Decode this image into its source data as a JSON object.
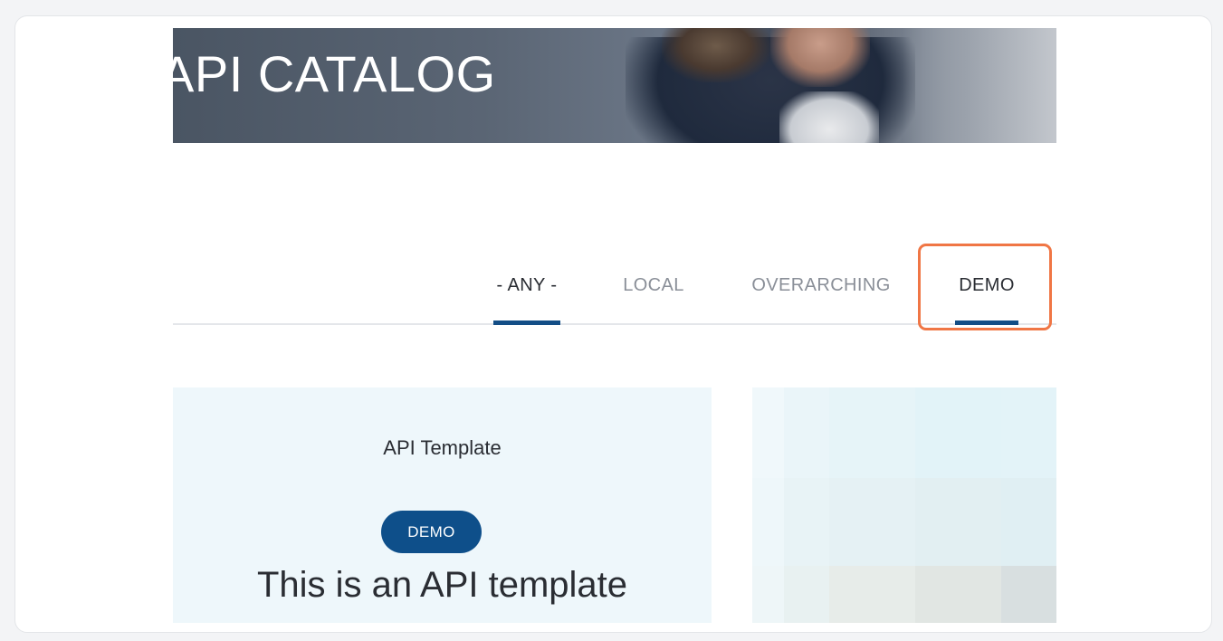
{
  "hero": {
    "title": "API CATALOG"
  },
  "tabs": [
    {
      "label": "- ANY -",
      "active": true
    },
    {
      "label": "LOCAL",
      "active": false
    },
    {
      "label": "OVERARCHING",
      "active": false
    },
    {
      "label": "DEMO",
      "active": true,
      "highlighted": true
    }
  ],
  "cards": [
    {
      "title": "API Template",
      "badge": "DEMO",
      "description": "This is an API template"
    }
  ],
  "colors": {
    "accent": "#134e86",
    "badge": "#0e4f8a",
    "highlight": "#f07645",
    "card_bg": "#eef7fb"
  }
}
